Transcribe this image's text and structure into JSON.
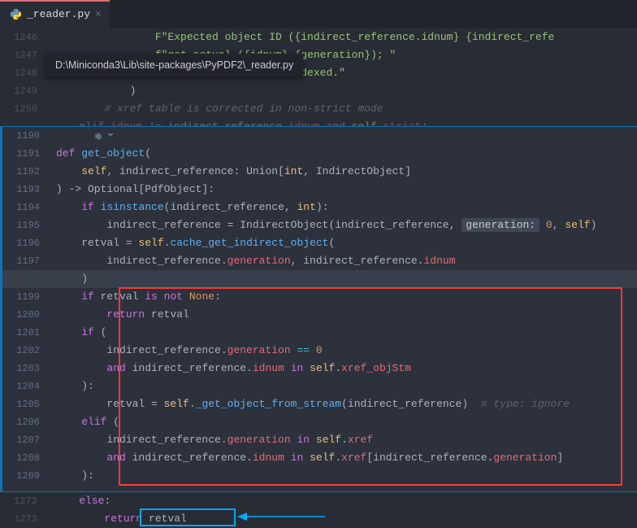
{
  "tab": {
    "filename": "_reader.py",
    "close_glyph": "×"
  },
  "tooltip_path": "D:\\Miniconda3\\Lib\\site-packages\\PyPDF2\\_reader.py",
  "top_lines": {
    "1246": [
      {
        "t": "                \"",
        " c": ""
      },
      {
        "t": "Expected object ID ({indirect_reference.idnum} {indirect_refe",
        "c": "str"
      }
    ],
    "1247": [
      {
        "t": "                ",
        "c": ""
      },
      {
        "t": "f\"got ",
        "c": "str"
      },
      {
        "t": "actual ({idnum} {generation})",
        "c": "str"
      },
      {
        "t": "; \"",
        "c": "str"
      }
    ],
    "1248": [
      {
        "t": "                ",
        "c": ""
      },
      {
        "t": "\"xref table not zero-indexed.\"",
        "c": "str"
      }
    ],
    "1249": [
      {
        "t": "            )",
        "c": ""
      }
    ],
    "1250": [
      {
        "t": "        ",
        "c": ""
      },
      {
        "t": "# xref table is corrected in non-strict mode",
        "c": "cmt"
      }
    ],
    "1251": [
      {
        "t": "    ",
        "c": ""
      },
      {
        "t": "elif",
        "c": "kw"
      },
      {
        "t": " ",
        "c": ""
      },
      {
        "t": "idnum",
        "c": "id"
      },
      {
        "t": " ",
        "c": ""
      },
      {
        "t": "!=",
        "c": "op"
      },
      {
        "t": " indirect_reference.",
        "c": ""
      },
      {
        "t": "idnum",
        "c": "id"
      },
      {
        "t": " ",
        "c": ""
      },
      {
        "t": "and",
        "c": "kw"
      },
      {
        "t": " ",
        "c": ""
      },
      {
        "t": "self",
        "c": "self"
      },
      {
        "t": ".",
        "c": ""
      },
      {
        "t": "strict",
        "c": "id"
      },
      {
        "t": ":",
        "c": ""
      }
    ]
  },
  "overlay_lines": {
    "1190": {
      "toolbar": true
    },
    "1191": [
      {
        "t": "def",
        "c": "kw"
      },
      {
        "t": " ",
        "c": ""
      },
      {
        "t": "get_object",
        "c": "fn"
      },
      {
        "t": "(",
        "c": ""
      }
    ],
    "1192": [
      {
        "t": "    ",
        "c": ""
      },
      {
        "t": "self",
        "c": "self"
      },
      {
        "t": ", indirect_reference: Union[",
        "c": ""
      },
      {
        "t": "int",
        "c": "typ"
      },
      {
        "t": ", IndirectObject]",
        "c": ""
      }
    ],
    "1193": [
      {
        "t": ") -> Optional[PdfObject]:",
        "c": ""
      }
    ],
    "1194": [
      {
        "t": "    ",
        "c": ""
      },
      {
        "t": "if",
        "c": "kw"
      },
      {
        "t": " ",
        "c": ""
      },
      {
        "t": "isinstance",
        "c": "fn"
      },
      {
        "t": "(indirect_reference, ",
        "c": ""
      },
      {
        "t": "int",
        "c": "typ"
      },
      {
        "t": "):",
        "c": ""
      }
    ],
    "1195": [
      {
        "t": "        indirect_reference = IndirectObject(indirect_reference, ",
        "c": ""
      },
      {
        "t": "generation:",
        "c": "pill"
      },
      {
        "t": " ",
        "c": ""
      },
      {
        "t": "0",
        "c": "num"
      },
      {
        "t": ", ",
        "c": ""
      },
      {
        "t": "self",
        "c": "self"
      },
      {
        "t": ")",
        "c": ""
      }
    ],
    "1196": [
      {
        "t": "    retval = ",
        "c": ""
      },
      {
        "t": "self",
        "c": "self"
      },
      {
        "t": ".",
        "c": ""
      },
      {
        "t": "cache_get_indirect_object",
        "c": "fn"
      },
      {
        "t": "(",
        "c": ""
      }
    ],
    "1197": [
      {
        "t": "        indirect_reference.",
        "c": ""
      },
      {
        "t": "generation",
        "c": "id"
      },
      {
        "t": ", indirect_reference.",
        "c": ""
      },
      {
        "t": "idnum",
        "c": "id"
      }
    ],
    "1198": [
      {
        "t": "    )",
        "c": ""
      }
    ],
    "1199": [
      {
        "t": "    ",
        "c": ""
      },
      {
        "t": "if",
        "c": "kw"
      },
      {
        "t": " retval ",
        "c": ""
      },
      {
        "t": "is not",
        "c": "kw"
      },
      {
        "t": " ",
        "c": ""
      },
      {
        "t": "None",
        "c": "num"
      },
      {
        "t": ":",
        "c": ""
      }
    ],
    "1200": [
      {
        "t": "        ",
        "c": ""
      },
      {
        "t": "return",
        "c": "kw"
      },
      {
        "t": " retval",
        "c": ""
      }
    ],
    "1201": [
      {
        "t": "    ",
        "c": ""
      },
      {
        "t": "if",
        "c": "kw"
      },
      {
        "t": " (",
        "c": ""
      }
    ],
    "1202": [
      {
        "t": "        indirect_reference.",
        "c": ""
      },
      {
        "t": "generation",
        "c": "id"
      },
      {
        "t": " ",
        "c": ""
      },
      {
        "t": "==",
        "c": "op"
      },
      {
        "t": " ",
        "c": ""
      },
      {
        "t": "0",
        "c": "num"
      }
    ],
    "1203": [
      {
        "t": "        ",
        "c": ""
      },
      {
        "t": "and",
        "c": "kw"
      },
      {
        "t": " indirect_reference.",
        "c": ""
      },
      {
        "t": "idnum",
        "c": "id"
      },
      {
        "t": " ",
        "c": ""
      },
      {
        "t": "in",
        "c": "kw"
      },
      {
        "t": " ",
        "c": ""
      },
      {
        "t": "self",
        "c": "self"
      },
      {
        "t": ".",
        "c": ""
      },
      {
        "t": "xref_objStm",
        "c": "id"
      }
    ],
    "1204": [
      {
        "t": "    ):",
        "c": ""
      }
    ],
    "1205": [
      {
        "t": "        retval = ",
        "c": ""
      },
      {
        "t": "self",
        "c": "self"
      },
      {
        "t": ".",
        "c": ""
      },
      {
        "t": "_get_object_from_stream",
        "c": "fn"
      },
      {
        "t": "(indirect_reference)  ",
        "c": ""
      },
      {
        "t": "# type: ignore",
        "c": "cmt"
      }
    ],
    "1206": [
      {
        "t": "    ",
        "c": ""
      },
      {
        "t": "elif",
        "c": "kw"
      },
      {
        "t": " (",
        "c": ""
      }
    ],
    "1207": [
      {
        "t": "        indirect_reference.",
        "c": ""
      },
      {
        "t": "generation",
        "c": "id"
      },
      {
        "t": " ",
        "c": ""
      },
      {
        "t": "in",
        "c": "kw"
      },
      {
        "t": " ",
        "c": ""
      },
      {
        "t": "self",
        "c": "self"
      },
      {
        "t": ".",
        "c": ""
      },
      {
        "t": "xref",
        "c": "id"
      }
    ],
    "1208": [
      {
        "t": "        ",
        "c": ""
      },
      {
        "t": "and",
        "c": "kw"
      },
      {
        "t": " indirect_reference.",
        "c": ""
      },
      {
        "t": "idnum",
        "c": "id"
      },
      {
        "t": " ",
        "c": ""
      },
      {
        "t": "in",
        "c": "kw"
      },
      {
        "t": " ",
        "c": ""
      },
      {
        "t": "self",
        "c": "self"
      },
      {
        "t": ".",
        "c": ""
      },
      {
        "t": "xref",
        "c": "id"
      },
      {
        "t": "[indirect_reference.",
        "c": ""
      },
      {
        "t": "generation",
        "c": "id"
      },
      {
        "t": "]",
        "c": ""
      }
    ],
    "1209": [
      {
        "t": "    ):",
        "c": ""
      }
    ]
  },
  "bottom_lines": {
    "1272": [
      {
        "t": "    ",
        "c": ""
      },
      {
        "t": "else",
        "c": "kw"
      },
      {
        "t": ":",
        "c": ""
      }
    ],
    "1273": [
      {
        "t": "        ",
        "c": ""
      },
      {
        "t": "return",
        "c": "kw"
      },
      {
        "t": " retval",
        "c": ""
      }
    ]
  }
}
